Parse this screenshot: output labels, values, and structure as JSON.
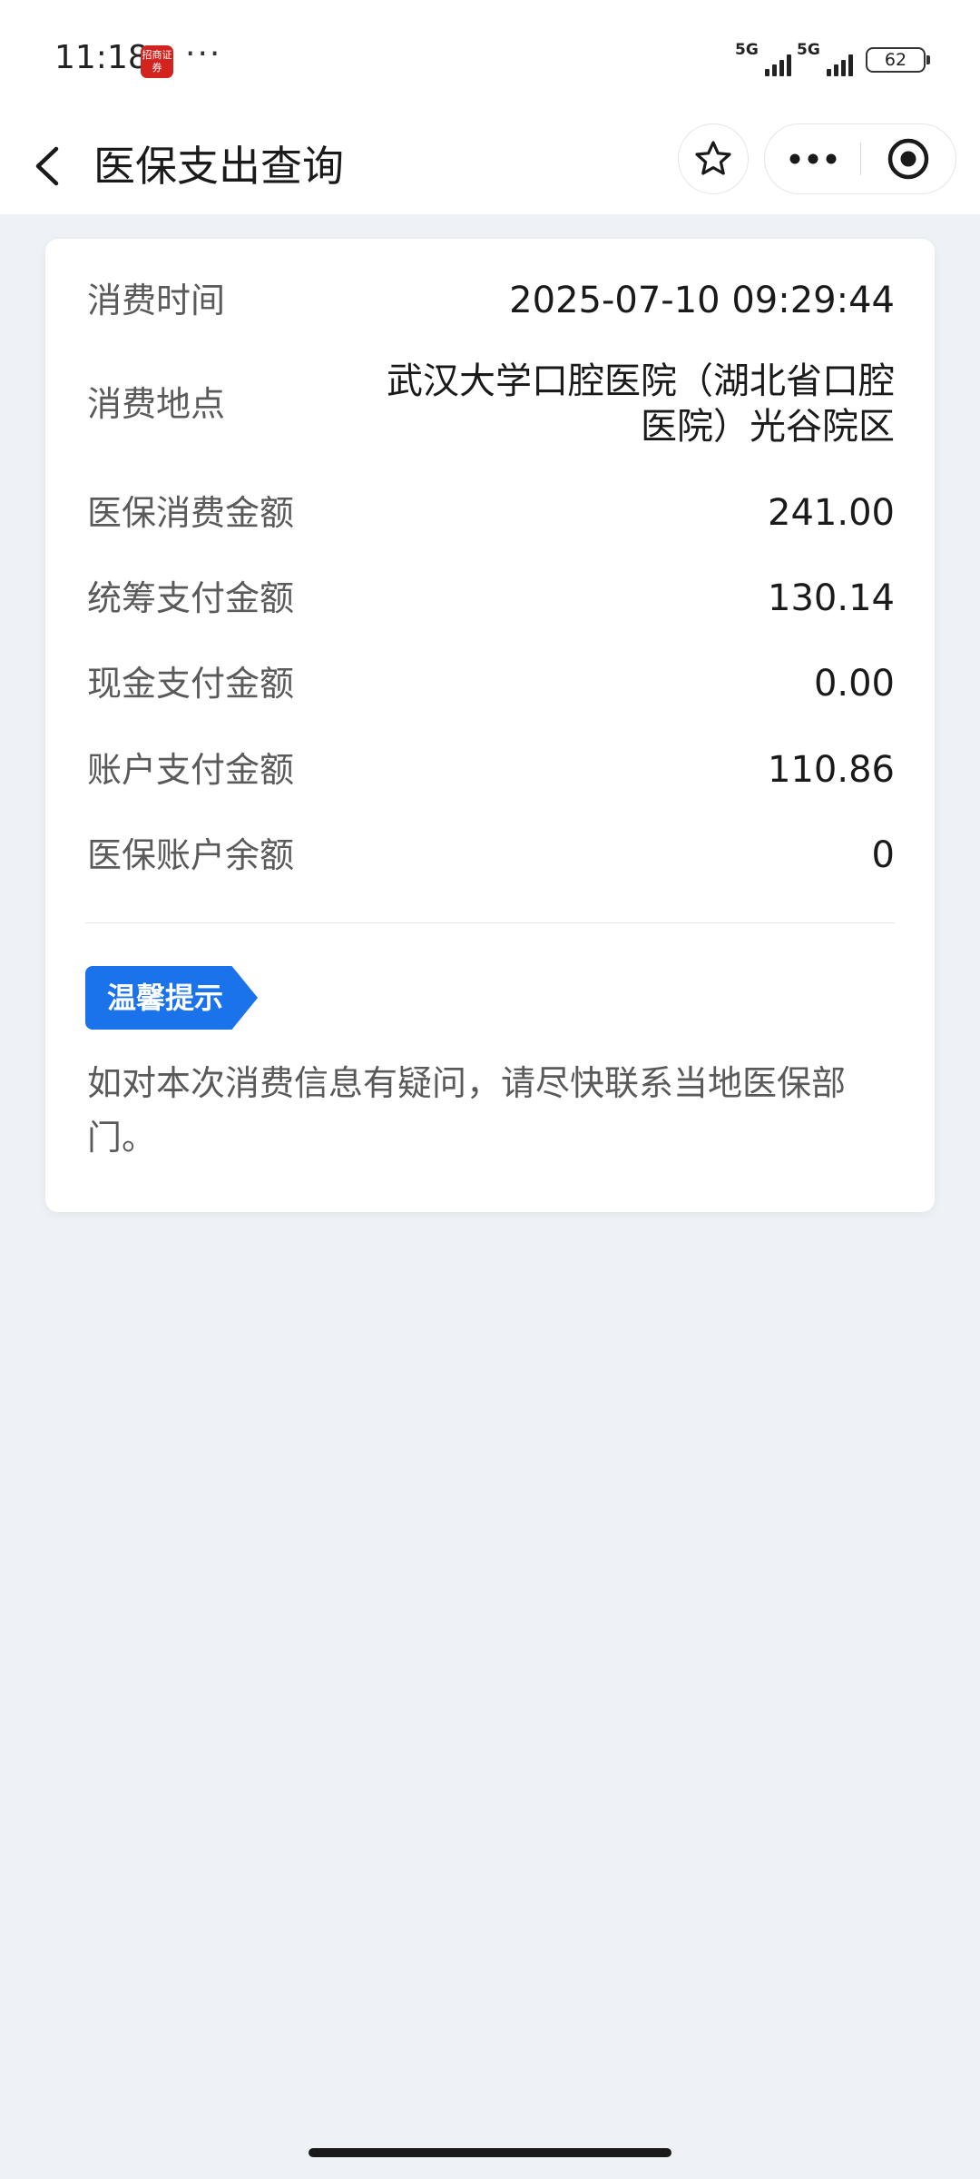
{
  "status_bar": {
    "time": "11:18",
    "app_icon_text": "招商证券",
    "dots": "···",
    "sim1_network": "5G",
    "sim2_network": "5G",
    "battery_level": "62"
  },
  "nav": {
    "title": "医保支出查询"
  },
  "details": {
    "consume_time_label": "消费时间",
    "consume_time_value": "2025-07-10 09:29:44",
    "consume_place_label": "消费地点",
    "consume_place_value": "武汉大学口腔医院（湖北省口腔医院）光谷院区",
    "medical_amount_label": "医保消费金额",
    "medical_amount_value": "241.00",
    "pooled_pay_label": "统筹支付金额",
    "pooled_pay_value": "130.14",
    "cash_pay_label": "现金支付金额",
    "cash_pay_value": "0.00",
    "account_pay_label": "账户支付金额",
    "account_pay_value": "110.86",
    "account_balance_label": "医保账户余额",
    "account_balance_value": "0"
  },
  "tip": {
    "tag": "温馨提示",
    "text": "如对本次消费信息有疑问，请尽快联系当地医保部门。"
  },
  "colors": {
    "accent": "#1a73ea",
    "background": "#eef1f6",
    "card": "#ffffff"
  }
}
